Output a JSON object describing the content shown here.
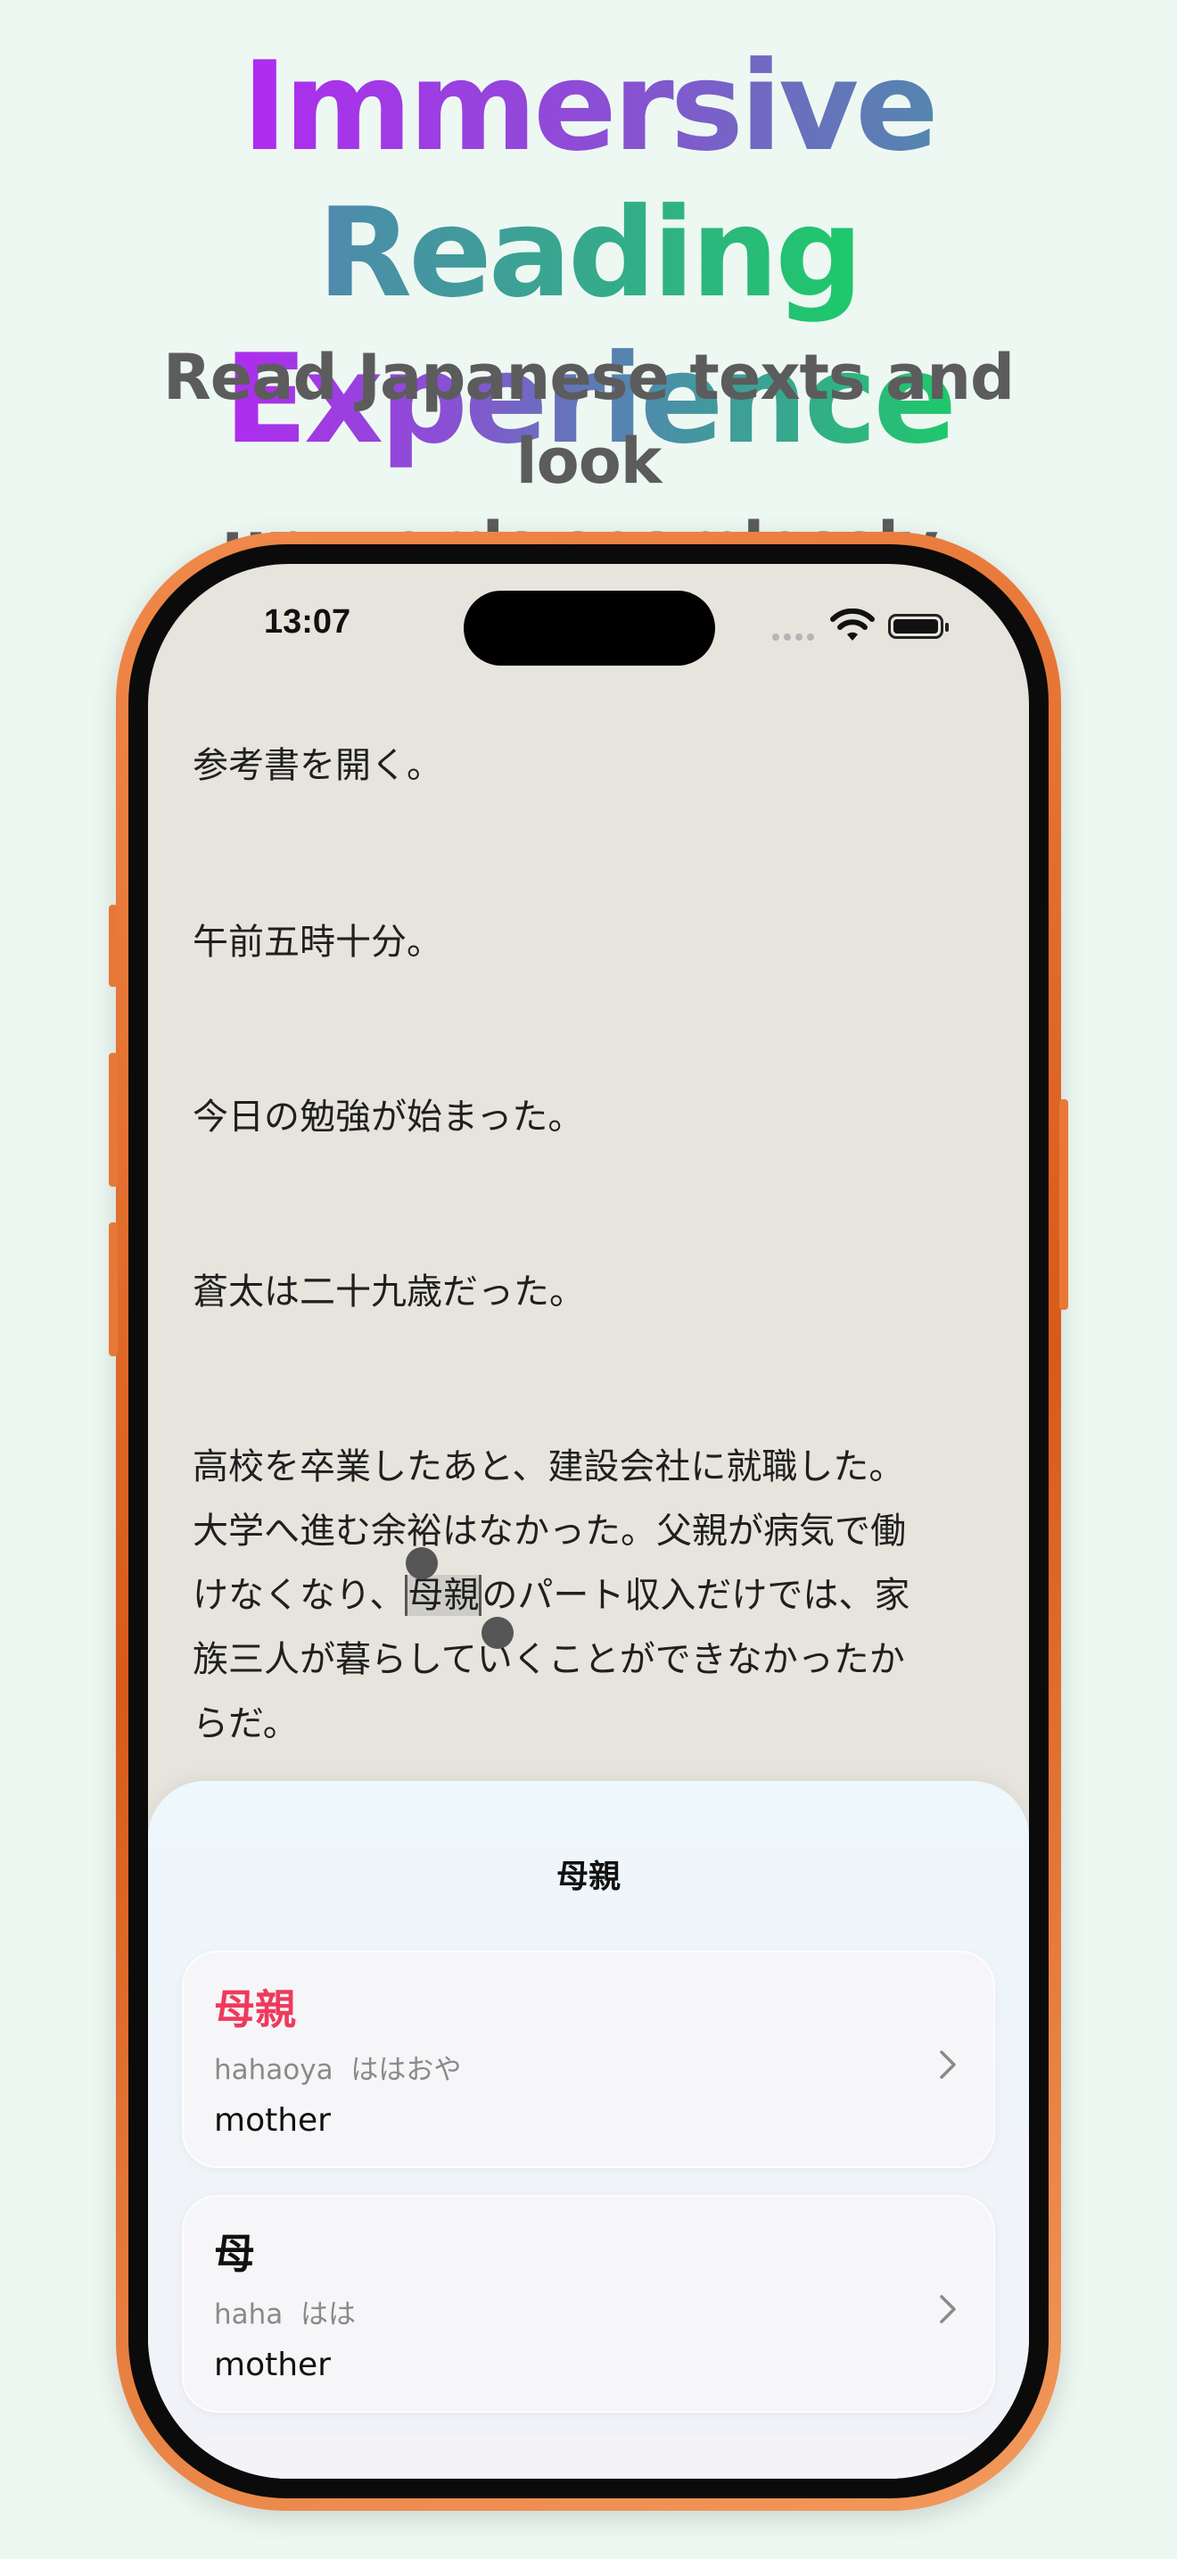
{
  "headline": {
    "line1": "Immersive Reading",
    "line2": "Experience",
    "subtitle_line1": "Read Japanese texts and look",
    "subtitle_line2": "up words seamlessly."
  },
  "status_bar": {
    "time": "13:07"
  },
  "reader": {
    "paragraphs": [
      [
        "参考書を開く。"
      ],
      [
        "午前五時十分。"
      ],
      [
        "今日の勉強が始まった。"
      ],
      [
        "蒼太は二十九歳だった。"
      ]
    ],
    "long_paragraph": {
      "line1": "高校を卒業したあと、建設会社に就職した。",
      "line2": "大学へ進む余裕はなかった。父親が病気で働",
      "line3_before": "けなくなり、",
      "line3_selected": "母親",
      "line3_after": "のパート収入だけでは、家",
      "line4": "族三人が暮らしていくことができなかったか",
      "line5": "らだ。"
    }
  },
  "lookup_sheet": {
    "title": "母親",
    "results": [
      {
        "word": "母親",
        "romaji": "hahaoya",
        "kana": "ははおや",
        "meaning": "mother",
        "word_color": "#ef3a5d"
      },
      {
        "word": "母",
        "romaji": "haha",
        "kana": "はは",
        "meaning": "mother",
        "word_color": "#111111"
      }
    ]
  }
}
